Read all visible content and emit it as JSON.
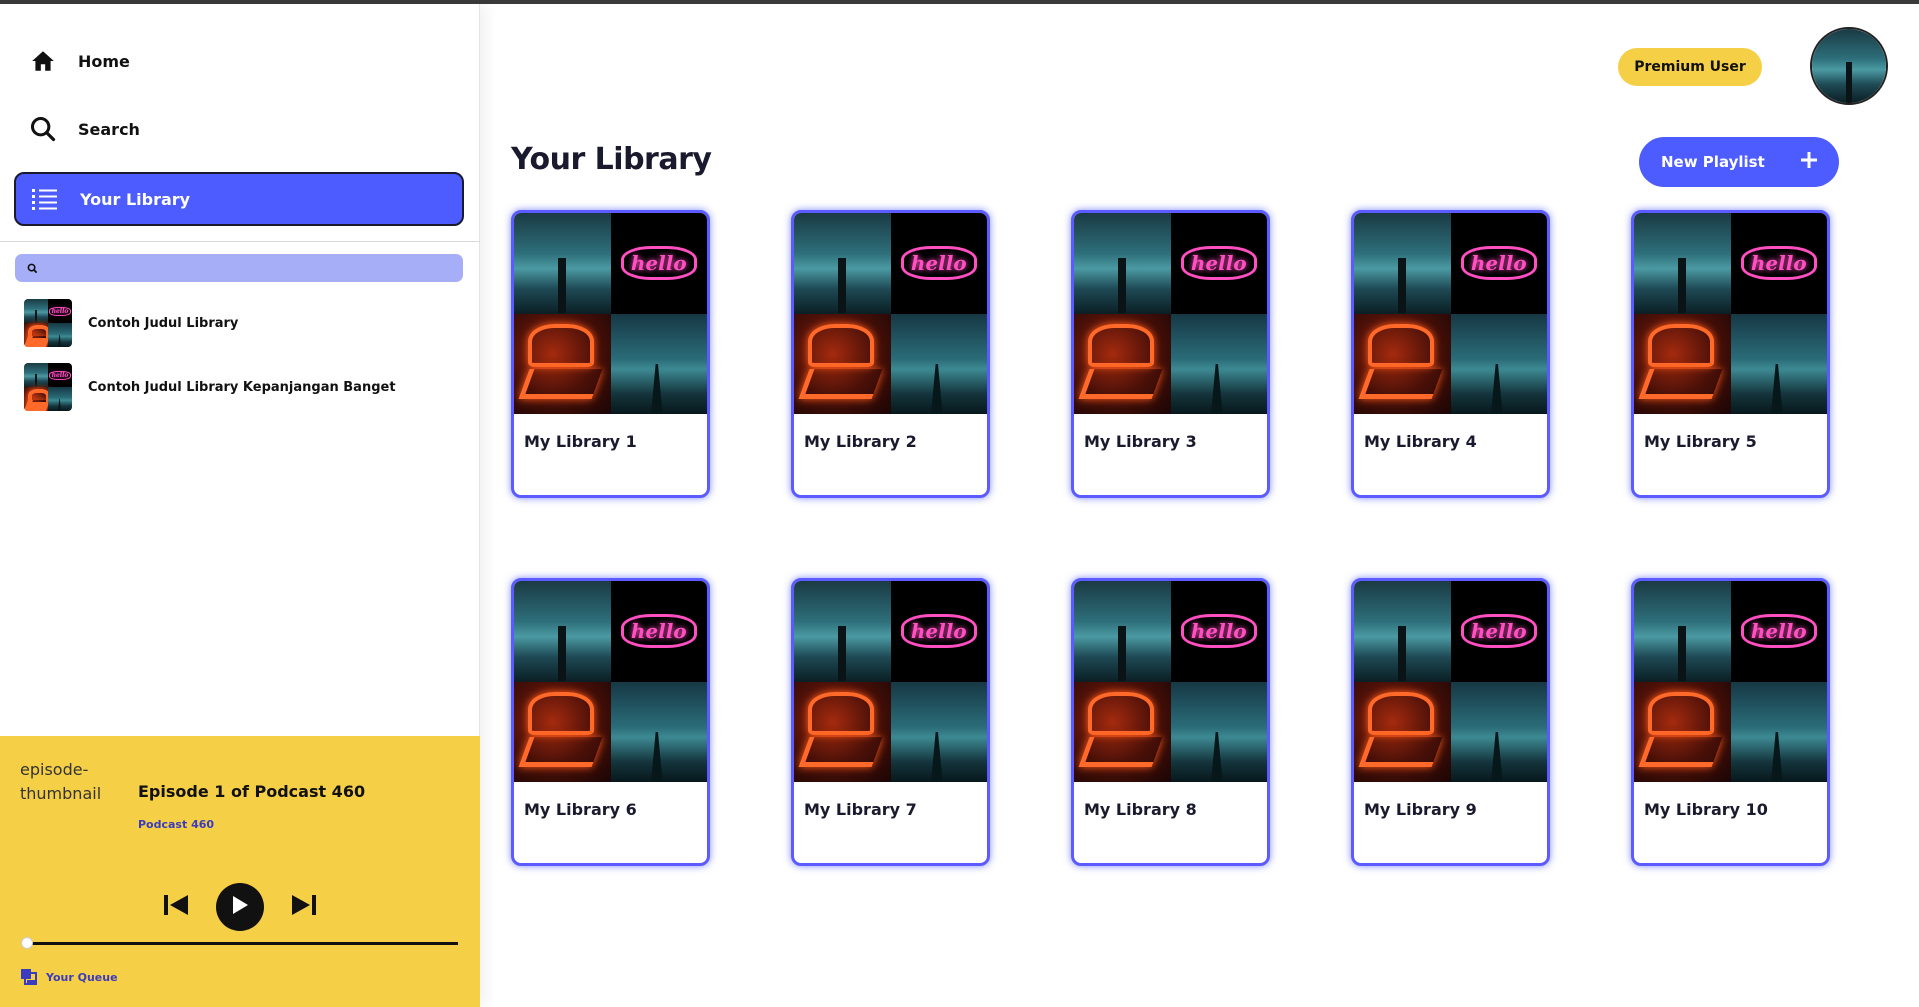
{
  "sidebar": {
    "nav": [
      {
        "label": "Home",
        "icon": "home-icon"
      },
      {
        "label": "Search",
        "icon": "search-icon"
      },
      {
        "label": "Your Library",
        "icon": "list-icon",
        "active": true
      }
    ],
    "search": {
      "placeholder": "",
      "value": ""
    },
    "library_items": [
      {
        "label": "Contoh Judul Library"
      },
      {
        "label": "Contoh Judul Library Kepanjangan Banget"
      }
    ]
  },
  "player": {
    "thumbnail_alt": "episode-thumbnail",
    "episode_title": "Episode 1 of Podcast 460",
    "podcast_name": "Podcast 460",
    "progress": 0,
    "queue_label": "Your Queue"
  },
  "header": {
    "premium_label": "Premium User"
  },
  "main": {
    "title": "Your Library",
    "new_playlist_label": "New Playlist",
    "cards": [
      {
        "title": "My Library 1"
      },
      {
        "title": "My Library 2"
      },
      {
        "title": "My Library 3"
      },
      {
        "title": "My Library 4"
      },
      {
        "title": "My Library 5"
      },
      {
        "title": "My Library 6"
      },
      {
        "title": "My Library 7"
      },
      {
        "title": "My Library 8"
      },
      {
        "title": "My Library 9"
      },
      {
        "title": "My Library 10"
      }
    ],
    "cover_text": "hello"
  },
  "colors": {
    "accent": "#4c5cff",
    "player_bg": "#f5cf45",
    "search_bg": "#a6aef7"
  }
}
